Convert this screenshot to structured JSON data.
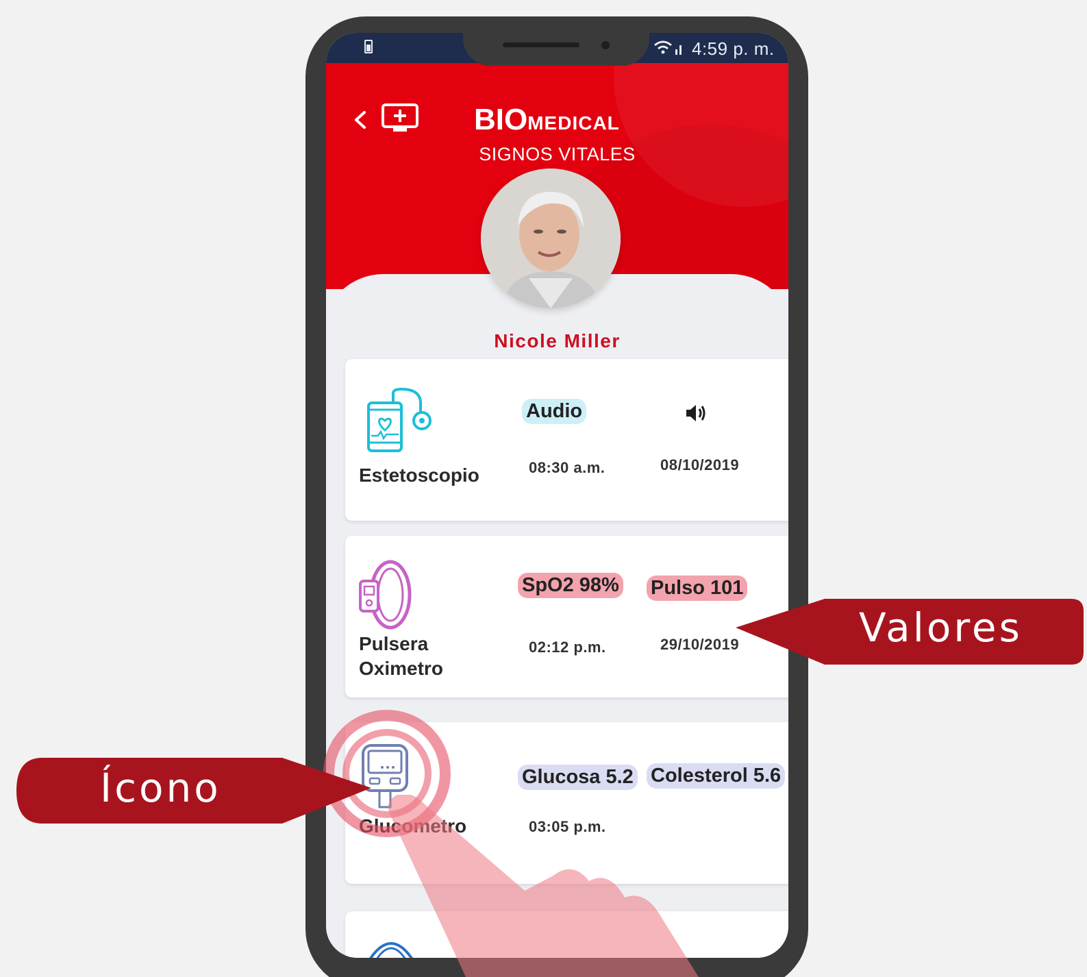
{
  "status_bar": {
    "time": "4:59 p. m."
  },
  "header": {
    "brand_bio": "BIO",
    "brand_medical": "MEDICAL",
    "title": "SIGNOS VITALES"
  },
  "patient": {
    "name": "Nicole Miller"
  },
  "devices": [
    {
      "name": "Estetoscopio",
      "icon": "stethoscope-phone-icon",
      "value_1": "Audio",
      "value_2_icon": "speaker-icon",
      "time": "08:30 a.m.",
      "date": "08/10/2019"
    },
    {
      "name_line1": "Pulsera",
      "name_line2": "Oximetro",
      "icon": "wristband-oximeter-icon",
      "value_1": "SpO2 98%",
      "value_2": "Pulso 101",
      "time": "02:12 p.m.",
      "date": "29/10/2019"
    },
    {
      "name": "Glucometro",
      "icon": "glucometer-icon",
      "value_1": "Glucosa 5.2",
      "value_2": "Colesterol 5.6",
      "time": "03:05 p.m."
    }
  ],
  "annotations": {
    "values_label": "Valores",
    "icon_label": "Ícono"
  },
  "colors": {
    "header_red": "#e3000f",
    "name_red": "#cc1020",
    "callout_red": "#a8141e",
    "status_bar": "#1e2c4e"
  }
}
